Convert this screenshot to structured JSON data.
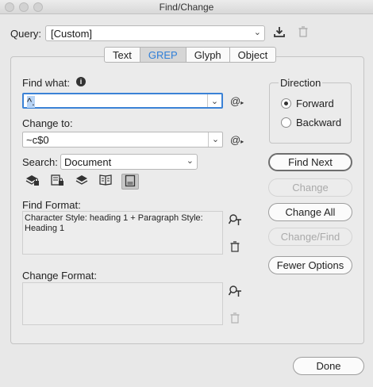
{
  "window": {
    "title": "Find/Change"
  },
  "query": {
    "label": "Query:",
    "value": "[Custom]"
  },
  "tabs": [
    {
      "label": "Text"
    },
    {
      "label": "GREP"
    },
    {
      "label": "Glyph"
    },
    {
      "label": "Object"
    }
  ],
  "find_what": {
    "label": "Find what:",
    "value": "^."
  },
  "change_to": {
    "label": "Change to:",
    "value": "~c$0"
  },
  "search": {
    "label": "Search:",
    "value": "Document"
  },
  "find_format": {
    "label": "Find Format:",
    "value": "Character Style: heading 1 + Paragraph Style: Heading 1"
  },
  "change_format": {
    "label": "Change Format:",
    "value": ""
  },
  "direction": {
    "label": "Direction",
    "options": [
      {
        "label": "Forward",
        "selected": true
      },
      {
        "label": "Backward",
        "selected": false
      }
    ]
  },
  "buttons": {
    "find_next": "Find Next",
    "change": "Change",
    "change_all": "Change All",
    "change_find": "Change/Find",
    "fewer_options": "Fewer Options",
    "done": "Done"
  },
  "colors": {
    "accent": "#2f7fd8",
    "focus_ring": "#3b82d6"
  }
}
